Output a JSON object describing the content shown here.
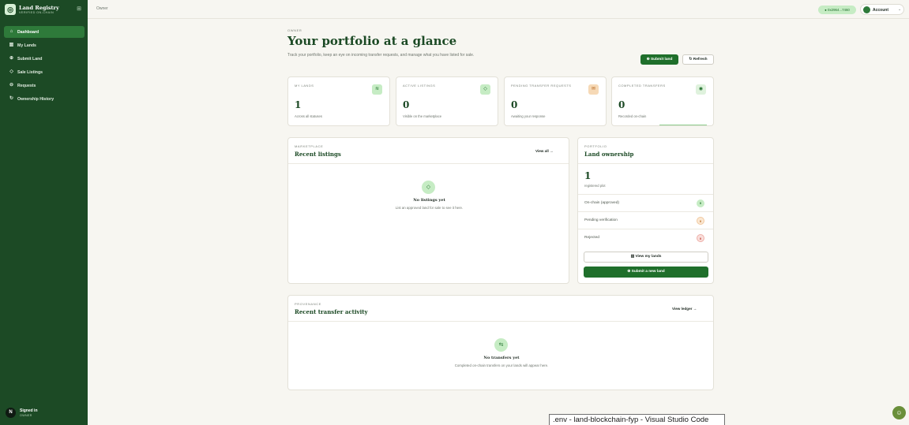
{
  "brand": {
    "title": "Land Registry",
    "subtitle": "VERIFIED ON-CHAIN",
    "logo_icon": "◎",
    "collapse_icon": "⊞"
  },
  "sidebar": {
    "items": [
      {
        "label": "Dashboard",
        "icon": "⌂",
        "active": true
      },
      {
        "label": "My Lands",
        "icon": "▥"
      },
      {
        "label": "Submit Land",
        "icon": "⊕"
      },
      {
        "label": "Sale Listings",
        "icon": "◇"
      },
      {
        "label": "Requests",
        "icon": "⊖"
      },
      {
        "label": "Ownership History",
        "icon": "↻"
      }
    ],
    "user": {
      "initial": "N",
      "name": "Signed in",
      "role": "OWNER"
    }
  },
  "topbar": {
    "breadcrumb": "Owner",
    "wallet": "● 0x2964...7460",
    "account_label": "Account",
    "account_caret": "⌄"
  },
  "header": {
    "eyebrow": "OWNER",
    "title": "Your portfolio at a glance",
    "description": "Track your portfolio, keep an eye on incoming transfer requests, and manage what you have listed for sale.",
    "submit_label": "⊕ Submit land",
    "refresh_label": "↻ Refresh"
  },
  "stats": [
    {
      "label": "MY LANDS",
      "value": "1",
      "hint": "Across all statuses",
      "icon": "≋"
    },
    {
      "label": "ACTIVE LISTINGS",
      "value": "0",
      "hint": "Visible on the marketplace",
      "icon": "◇"
    },
    {
      "label": "PENDING TRANSFER REQUESTS",
      "value": "0",
      "hint": "Awaiting your response",
      "icon": "✉"
    },
    {
      "label": "COMPLETED TRANSFERS",
      "value": "0",
      "hint": "Recorded on-chain",
      "icon": "◉"
    }
  ],
  "listings": {
    "eyebrow": "MARKETPLACE",
    "title": "Recent listings",
    "view_all": "View all →",
    "empty_icon": "◇",
    "empty_title": "No listings yet",
    "empty_text": "List an approved land for sale to see it here."
  },
  "ownership": {
    "eyebrow": "PORTFOLIO",
    "title": "Land ownership",
    "count": "1",
    "count_label": "registered plot",
    "rows": [
      {
        "label": "On-chain (approved)",
        "value": "0"
      },
      {
        "label": "Pending verification",
        "value": "0"
      },
      {
        "label": "Rejected",
        "value": "0"
      }
    ],
    "view_lands": "▥ View my lands",
    "submit_new": "⊕ Submit a new land"
  },
  "activity": {
    "eyebrow": "PROVENANCE",
    "title": "Recent transfer activity",
    "view_ledger": "View ledger →",
    "empty_icon": "⇆",
    "empty_title": "No transfers yet",
    "empty_text": "Completed on-chain transfers on your lands will appear here."
  },
  "taskbar": {
    "tooltip": ".env - land-blockchain-fyp - Visual Studio Code",
    "tray_icon": "☺"
  },
  "colors": {
    "brand_green": "#1c4a25",
    "accent": "#1f6f2b",
    "soft_green": "#c6ecc4",
    "warn": "#f6d9b6",
    "danger": "#f4cfcc"
  }
}
